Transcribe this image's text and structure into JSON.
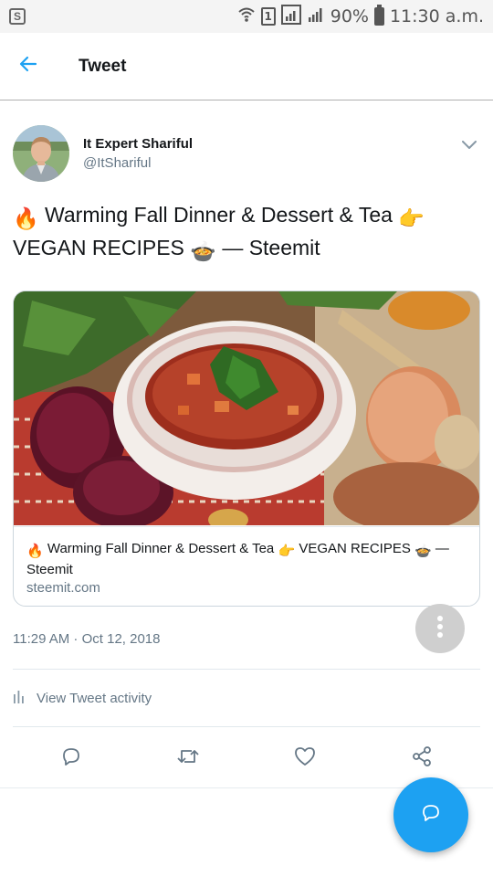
{
  "status_bar": {
    "app_badge": "S",
    "sim_label": "1",
    "battery": "90%",
    "time": "11:30 a.m."
  },
  "header": {
    "title": "Tweet"
  },
  "author": {
    "name": "It Expert Shariful",
    "handle": "@ItShariful"
  },
  "tweet": {
    "emoji_fire": "🔥",
    "text_part1": "Warming Fall Dinner & Dessert & Tea",
    "emoji_point": "👉",
    "text_part2": "VEGAN RECIPES",
    "emoji_bowl": "🍲",
    "text_part3": "— Steemit"
  },
  "card": {
    "emoji_fire": "🔥",
    "title_part1": "Warming Fall Dinner & Dessert & Tea",
    "emoji_point": "👉",
    "title_part2": "VEGAN RECIPES",
    "emoji_bowl": "🍲",
    "title_part3": "— Steemit",
    "domain": "steemit.com"
  },
  "timestamp": "11:29 AM · Oct 12, 2018",
  "activity_label": "View Tweet activity",
  "icons": {
    "back": "arrow-left-icon",
    "chevron": "chevron-down-icon",
    "more": "more-vertical-icon",
    "activity": "bar-chart-icon",
    "reply": "reply-icon",
    "retweet": "retweet-icon",
    "like": "heart-icon",
    "share": "share-icon",
    "compose": "compose-reply-icon"
  },
  "colors": {
    "accent": "#1da1f2",
    "text_primary": "#14171a",
    "text_secondary": "#657786",
    "border": "#e1e8ed"
  }
}
